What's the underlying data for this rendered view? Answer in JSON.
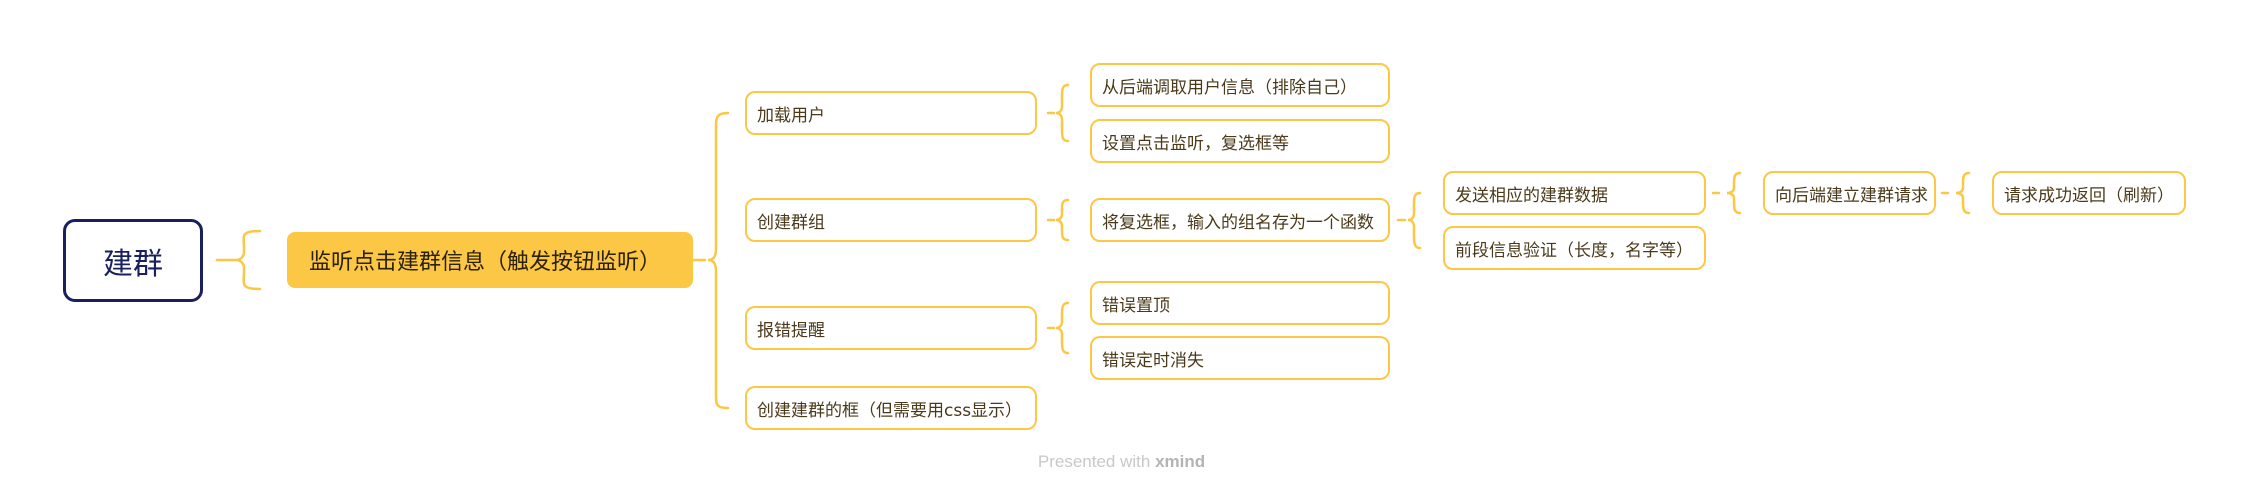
{
  "mindmap": {
    "root": {
      "label": "建群"
    },
    "main_topic": {
      "label": "监听点击建群信息（触发按钮监听）"
    },
    "level1": [
      {
        "label": "加载用户"
      },
      {
        "label": "创建群组"
      },
      {
        "label": "报错提醒"
      },
      {
        "label": "创建建群的框（但需要用css显示）"
      }
    ],
    "level2": [
      {
        "label": "从后端调取用户信息（排除自己）"
      },
      {
        "label": "设置点击监听，复选框等"
      },
      {
        "label": "将复选框，输入的组名存为一个函数"
      },
      {
        "label": "错误置顶"
      },
      {
        "label": "错误定时消失"
      }
    ],
    "level3": [
      {
        "label": "发送相应的建群数据"
      },
      {
        "label": "前段信息验证（长度，名字等）"
      }
    ],
    "level4": [
      {
        "label": "向后端建立建群请求"
      }
    ],
    "level5": [
      {
        "label": "请求成功返回（刷新）"
      }
    ]
  },
  "footer": {
    "prefix": "Presented with ",
    "brand": "xmind"
  },
  "colors": {
    "accent": "#fdc746",
    "root_border": "#1a1f5e",
    "text": "#4a3a1a",
    "footer": "#c8c8c8"
  }
}
